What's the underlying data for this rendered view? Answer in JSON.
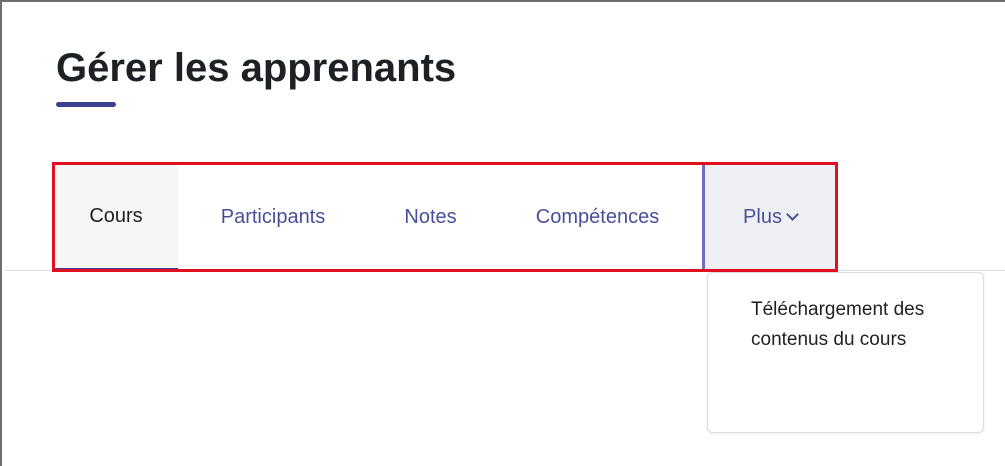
{
  "page": {
    "title": "Gérer les apprenants"
  },
  "tabs": [
    {
      "label": "Cours",
      "active": true
    },
    {
      "label": "Participants",
      "active": false
    },
    {
      "label": "Notes",
      "active": false
    },
    {
      "label": "Compétences",
      "active": false
    },
    {
      "label": "Plus",
      "active": false,
      "icon": "chevron-down-icon"
    }
  ],
  "dropdown": {
    "items": [
      {
        "label": "Téléchargement des contenus du cours"
      }
    ]
  },
  "colors": {
    "accent": "#3b3f8f",
    "link": "#4a4f9a",
    "highlight": "#e01020"
  }
}
